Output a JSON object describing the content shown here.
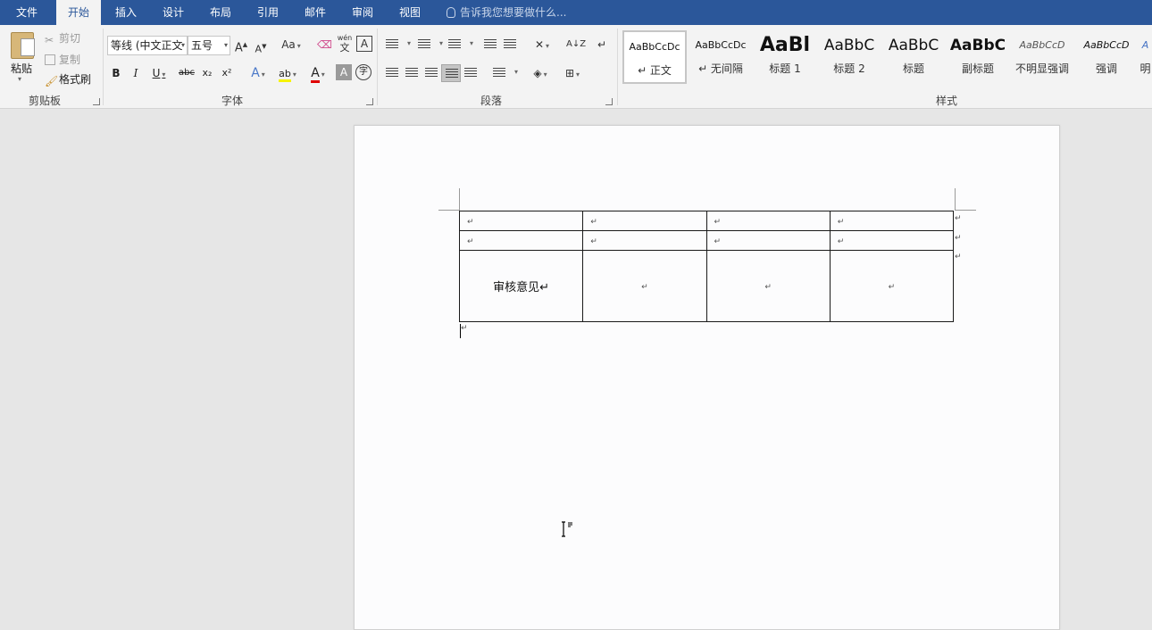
{
  "tabs": [
    "文件",
    "开始",
    "插入",
    "设计",
    "布局",
    "引用",
    "邮件",
    "审阅",
    "视图"
  ],
  "active_tab": "开始",
  "tell_me": "告诉我您想要做什么...",
  "clipboard": {
    "paste": "粘贴",
    "cut": "剪切",
    "copy": "复制",
    "format_painter": "格式刷",
    "group_label": "剪贴板"
  },
  "font": {
    "name": "等线 (中文正文",
    "size": "五号",
    "grow": "A",
    "shrink": "A",
    "case": "Aa",
    "phonetic": "wén",
    "phonetic_char": "文",
    "border_char": "A",
    "bold": "B",
    "italic": "I",
    "underline": "U",
    "strike": "abc",
    "subscript": "x₂",
    "superscript": "x²",
    "effects": "A",
    "highlight": "ab",
    "color": "A",
    "shading": "A",
    "enclose": "字",
    "group_label": "字体"
  },
  "paragraph": {
    "group_label": "段落",
    "sort": "A↓Z"
  },
  "styles": {
    "group_label": "样式",
    "items": [
      {
        "sample": "AaBbCcDc",
        "name": "↵ 正文"
      },
      {
        "sample": "AaBbCcDc",
        "name": "↵ 无间隔"
      },
      {
        "sample": "AaBl",
        "name": "标题 1"
      },
      {
        "sample": "AaBbC",
        "name": "标题 2"
      },
      {
        "sample": "AaBbC",
        "name": "标题"
      },
      {
        "sample": "AaBbC",
        "name": "副标题"
      },
      {
        "sample": "AaBbCcD",
        "name": "不明显强调"
      },
      {
        "sample": "AaBbCcD",
        "name": "强调"
      },
      {
        "sample": "A",
        "name": "明"
      }
    ]
  },
  "document": {
    "table": {
      "rows": [
        [
          "↵",
          "↵",
          "↵",
          "↵"
        ],
        [
          "↵",
          "↵",
          "↵",
          "↵"
        ],
        [
          "审核意见↵",
          "↵",
          "↵",
          "↵"
        ]
      ],
      "row_end_mark": "↵"
    },
    "after_table_mark": "↵"
  }
}
